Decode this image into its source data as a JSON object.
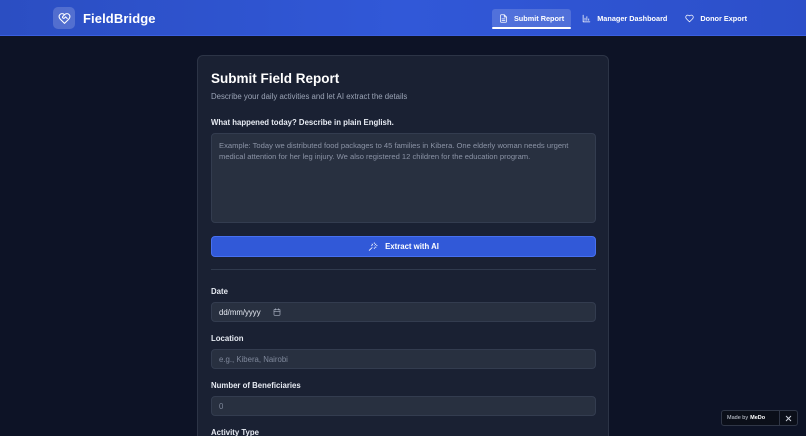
{
  "app": {
    "name": "FieldBridge",
    "logo_icon": "heart-handshake-icon"
  },
  "nav": [
    {
      "label": "Submit Report",
      "icon": "document-icon",
      "active": true
    },
    {
      "label": "Manager Dashboard",
      "icon": "bar-chart-icon",
      "active": false
    },
    {
      "label": "Donor Export",
      "icon": "heart-icon",
      "active": false
    }
  ],
  "form": {
    "title": "Submit Field Report",
    "subtitle": "Describe your daily activities and let AI extract the details",
    "description_label": "What happened today? Describe in plain English.",
    "description_placeholder": "Example: Today we distributed food packages to 45 families in Kibera. One elderly woman needs urgent medical attention for her leg injury. We also registered 12 children for the education program.",
    "extract_button": "Extract with AI",
    "date_label": "Date",
    "date_value": "dd/mm/yyyy",
    "location_label": "Location",
    "location_placeholder": "e.g., Kibera, Nairobi",
    "beneficiaries_label": "Number of Beneficiaries",
    "beneficiaries_value": "0",
    "activity_type_label": "Activity Type"
  },
  "badge": {
    "prefix": "Made by",
    "brand": "MeDo"
  },
  "colors": {
    "header": "#2c50cc",
    "background": "#0d1326",
    "card": "#1a2133",
    "accent": "#3159d8"
  }
}
